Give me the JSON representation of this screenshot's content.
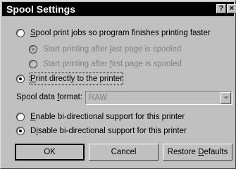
{
  "window": {
    "title": "Spool Settings",
    "help_glyph": "?",
    "close_glyph": "×"
  },
  "options": {
    "spool": {
      "pre": "",
      "ul": "S",
      "post": "pool print jobs so program finishes printing faster",
      "selected": false,
      "enabled": true
    },
    "start_last": {
      "pre": "Start printing after ",
      "ul": "l",
      "post": "ast page is spooled",
      "selected": true,
      "enabled": false
    },
    "start_first": {
      "pre": "Start printing after ",
      "ul": "f",
      "post": "irst page is spooled",
      "selected": false,
      "enabled": false
    },
    "direct": {
      "pre": "",
      "ul": "P",
      "post": "rint directly to the printer",
      "selected": true,
      "enabled": true
    },
    "enable_bidi": {
      "pre": "",
      "ul": "E",
      "post": "nable bi-directional support for this printer",
      "selected": false,
      "enabled": true
    },
    "disable_bidi": {
      "pre": "D",
      "ul": "i",
      "post": "sable bi-directional support for this printer",
      "selected": true,
      "enabled": true
    }
  },
  "spool_format": {
    "label_pre": "Spool data ",
    "label_ul": "f",
    "label_post": "ormat:",
    "value": "RAW"
  },
  "buttons": {
    "ok": "OK",
    "cancel": "Cancel",
    "restore_pre": "Restore ",
    "restore_ul": "D",
    "restore_post": "efaults"
  }
}
